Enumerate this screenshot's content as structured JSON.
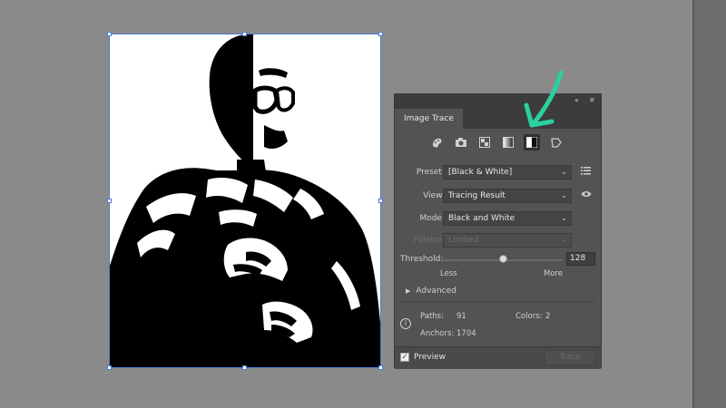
{
  "panel": {
    "tab_title": "Image Trace",
    "collapse_glyph": "«",
    "close_glyph": "✕",
    "preset_icons": [
      "auto-color-icon",
      "high-color-icon",
      "low-color-icon",
      "grayscale-icon",
      "black-and-white-icon",
      "outline-icon"
    ],
    "active_preset_icon": "black-and-white-icon",
    "preset": {
      "label": "Preset:",
      "value": "[Black & White]"
    },
    "view": {
      "label": "View:",
      "value": "Tracing Result"
    },
    "mode": {
      "label": "Mode:",
      "value": "Black and White"
    },
    "palette": {
      "label": "Palette:",
      "value": "Limited"
    },
    "threshold": {
      "label": "Threshold:",
      "value": "128",
      "min": 1,
      "max": 255,
      "less": "Less",
      "more": "More"
    },
    "advanced": "Advanced",
    "stats": {
      "paths_label": "Paths:",
      "paths_value": "91",
      "colors_label": "Colors:",
      "colors_value": "2",
      "anchors_label": "Anchors:",
      "anchors_value": "1704"
    },
    "preview_label": "Preview",
    "preview_checked": true,
    "trace_button": "Trace"
  },
  "colors": {
    "workspace": "#8a8a8a",
    "panel_bg": "#535353",
    "selection": "#4a7bd4",
    "arrow": "#29d1a0"
  }
}
